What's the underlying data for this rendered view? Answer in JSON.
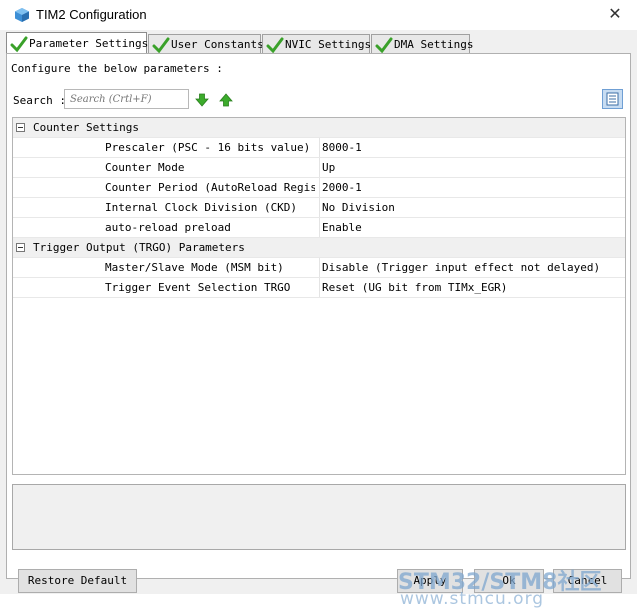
{
  "window": {
    "title": "TIM2 Configuration",
    "close_glyph": "✕"
  },
  "tabs": [
    {
      "label": "Parameter Settings",
      "icon": "check-icon",
      "active": true
    },
    {
      "label": "User Constants",
      "icon": "check-icon",
      "active": false
    },
    {
      "label": "NVIC Settings",
      "icon": "check-icon",
      "active": false
    },
    {
      "label": "DMA Settings",
      "icon": "check-icon",
      "active": false
    }
  ],
  "panel": {
    "configure_label": "Configure the below parameters :",
    "search_label": "Search :",
    "search_placeholder": "Search (Crtl+F)"
  },
  "groups": [
    {
      "name": "Counter Settings",
      "params": [
        {
          "name": "Prescaler (PSC - 16 bits value)",
          "value": "8000-1"
        },
        {
          "name": "Counter Mode",
          "value": "Up"
        },
        {
          "name": "Counter Period (AutoReload Regis...",
          "value": "2000-1"
        },
        {
          "name": "Internal Clock Division (CKD)",
          "value": "No Division"
        },
        {
          "name": "auto-reload preload",
          "value": "Enable"
        }
      ]
    },
    {
      "name": "Trigger Output (TRGO) Parameters",
      "params": [
        {
          "name": "Master/Slave Mode (MSM bit)",
          "value": "Disable (Trigger input effect not delayed)"
        },
        {
          "name": "Trigger Event Selection TRGO",
          "value": "Reset (UG bit from TIMx_EGR)"
        }
      ]
    }
  ],
  "buttons": {
    "restore_default": "Restore Default",
    "apply": "Apply",
    "ok": "Ok",
    "cancel": "Cancel"
  },
  "watermark": {
    "line1": "STM32/STM8社区",
    "line2": "www.stmcu.org"
  },
  "colors": {
    "check_green": "#3aa12a",
    "arrow_green": "#3cab2c",
    "list_button": "#c7dcf2"
  }
}
